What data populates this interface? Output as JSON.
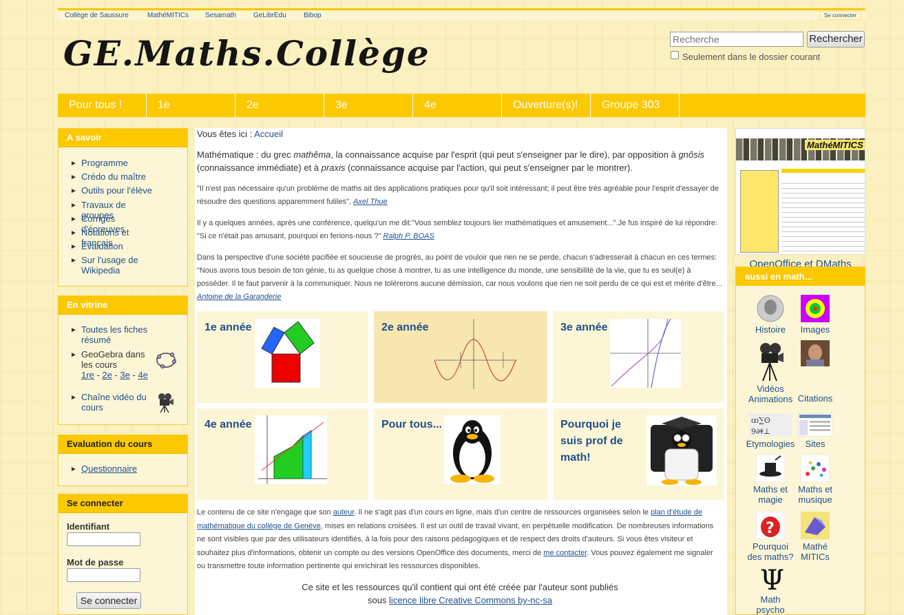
{
  "top_links": [
    "Collège de Saussure",
    "MathéMITICs",
    "Sesamath",
    "GeLibrEdu",
    "Bibop"
  ],
  "top_login": "Se connecter",
  "logo_text": "GE.Maths.Collège",
  "search": {
    "placeholder": "Recherche",
    "button": "Rechercher",
    "checkbox_label": "Seulement dans le dossier courant"
  },
  "nav": [
    "Pour tous !",
    "1e",
    "2e",
    "3e",
    "4e",
    "Ouverture(s)!",
    "Groupe 303"
  ],
  "sidebar": {
    "a_savoir": {
      "title": "A savoir",
      "items": [
        "Programme",
        "Crédo du maître",
        "Outils pour l'élève",
        "Travaux de groupes",
        "Corrigés d'épreuves",
        "Notations et français",
        "Evaluation",
        "Sur l'usage de Wikipedia"
      ]
    },
    "vitrine": {
      "title": "En vitrine",
      "item1": "Toutes les fiches résumé",
      "item2": "GeoGebra dans les cours",
      "item2_links": [
        "1re",
        "2e",
        "3e",
        "4e"
      ],
      "item3": "Chaîne vidéo du cours"
    },
    "evaluation": {
      "title": "Evaluation du cours",
      "items": [
        "Questionnaire"
      ]
    },
    "login": {
      "title": "Se connecter",
      "id_label": "Identifiant",
      "pw_label": "Mot de passe",
      "button": "Se connecter"
    }
  },
  "breadcrumb": {
    "prefix": "Vous êtes ici :",
    "home": "Accueil"
  },
  "intro": {
    "a": "Mathématique : du grec ",
    "b": "mathêma",
    "c": ", la connaissance acquise par l'esprit (qui peut s'enseigner par le dire), par opposition à ",
    "d": "gnôsis",
    "e": " (connaissance immédiate) et à ",
    "f": "praxis",
    "g": " (connaissance acquise par l'action, qui peut s'enseigner par le montrer)."
  },
  "quotes": [
    {
      "text": "\"Il n'est pas nécessaire qu'un problème de maths ait des applications pratiques pour qu'il soit intéressant; il peut être très agréable pour l'esprit d'essayer de résoudre des questions apparemment futiles\", ",
      "author": "Axel Thue"
    },
    {
      "text": "Il y a quelques années, après une conférence, quelqu'un me dit:\"Vous semblez toujours lier mathématiques et amusement...\".Je fus inspiré de lui répondre: \"Si ce n'était pas amusant, pourquoi en ferions-nous ?\" ",
      "author": "Ralph P. BOAS"
    },
    {
      "text": "Dans la perspective d'une société pacifiée et soucieuse de progrès, au point de vouloir que rien ne se perde, chacun s'adresserait à chacun en ces termes: \"Nous avons tous besoin de ton génie, tu as quelque chose à montrer, tu as une intelligence du monde, une sensibilité de la vie, que tu es seul(e) à posséder. Il te faut parvenir à la communiquer. Nous ne tolérerons aucune démission, car nous voulons que rien ne soit perdu de ce qui est et mérite d'être... ",
      "author": "Antoine de la Garanderie"
    }
  ],
  "tiles": [
    "1e année",
    "2e année",
    "3e année",
    "4e année",
    "Pour tous...",
    "Pourquoi je suis prof de math!"
  ],
  "legal": {
    "a": "Le contenu de ce site n'engage que son ",
    "link1": "auteur",
    "b": ".  Il ne s'agit pas d'un cours en ligne, mais d'un centre de ressources organisées selon le ",
    "link2": "plan d'étude de mathématique du collège de Genève",
    "c": ", mises en relations croisées. Il est un outil de travail vivant, en perpétuelle modification. De nombreuses informations ne sont visibles que par des utilisateurs identifiés, à la fois pour des raisons pédagogiques et de respect des droits d'auteurs. Si vous êtes visiteur et souhaitez plus d'informations, obtenir un compte ou des versions OpenOffice des documents, merci de ",
    "link3": "me contacter",
    "d": ". Vous pouvez également me signaler ou transmettre toute information pertinente qui enrichirait les ressources disponibles."
  },
  "licence": {
    "line1": "Ce site et les ressources qu'il contient qui ont été créée par l'auteur sont publiés",
    "pre": "sous ",
    "link": "licence libre Creative Commons by-nc-sa"
  },
  "right": {
    "banner_title": "MathéMITICS",
    "caption": "OpenOffice et DMaths",
    "portlet_title": "aussi en math...",
    "icons": [
      "Histoire",
      "Images",
      "Vidéos Animations",
      "Citations",
      "Etymologies",
      "Sites",
      "Maths et magie",
      "Maths et musique",
      "Pourquoi des maths?",
      "Mathé MITICs",
      "Math psycho"
    ]
  },
  "colors": {
    "accent": "#fcc800",
    "link": "#1f4f8c",
    "tile_bg": "#fcf6d6"
  }
}
